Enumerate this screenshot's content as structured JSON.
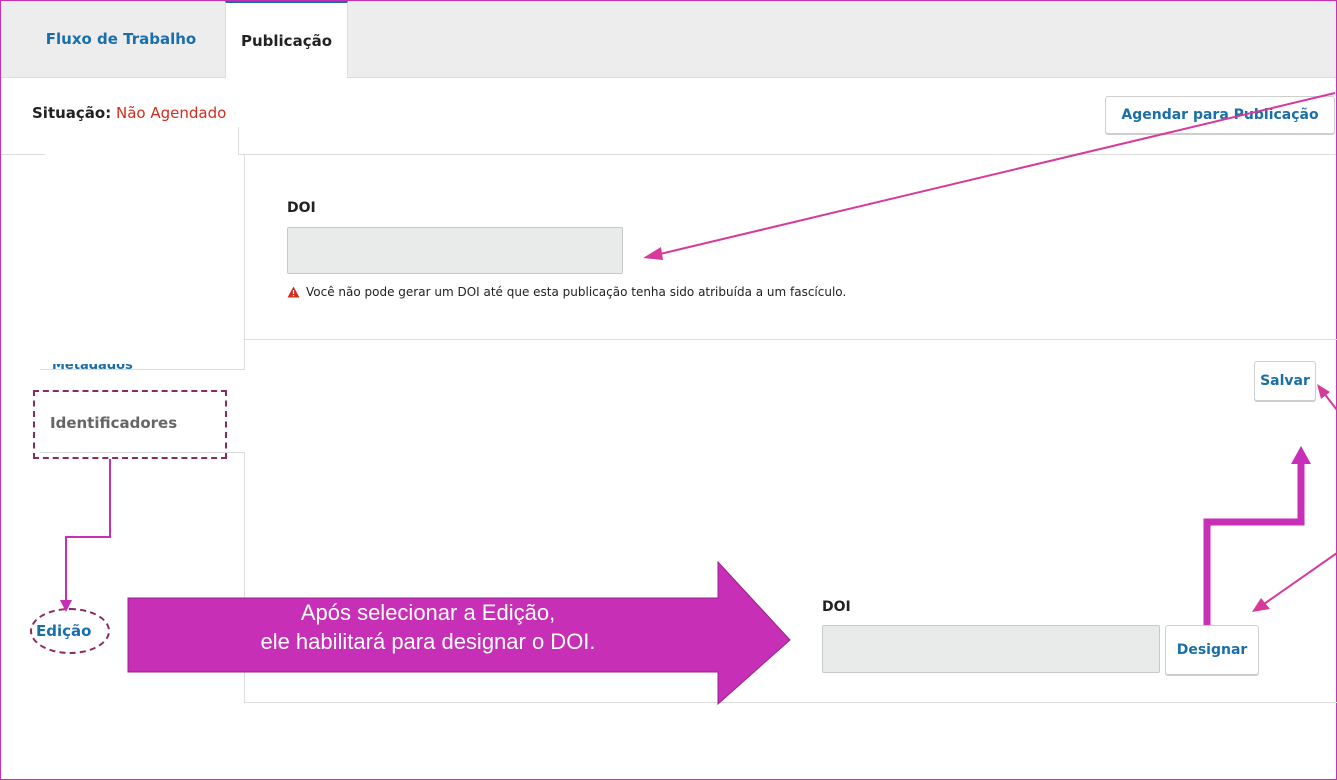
{
  "tabs": [
    {
      "label": "Fluxo de Trabalho"
    },
    {
      "label": "Publicação",
      "active": true
    }
  ],
  "status": {
    "label": "Situação:",
    "value": "Não Agendado"
  },
  "header": {
    "schedule_button": "Agendar para Publicação"
  },
  "sidebar": {
    "items": [
      {
        "label": "Identificadores"
      },
      {
        "label": "Edição"
      }
    ]
  },
  "doi_panel": {
    "label": "DOI",
    "value": "",
    "warning": "Você não pode gerar um DOI até que esta publicação tenha sido atribuída a um fascículo.",
    "save_button": "Salvar"
  },
  "doi_assign": {
    "label": "DOI",
    "value": "",
    "assign_button": "Designar"
  },
  "annotation": {
    "line1": "Após selecionar a Edição,",
    "line2": "ele habilitará para designar o DOI."
  },
  "colors": {
    "accent": "#1a6fa8",
    "status_red": "#d52b1e",
    "annotation_magenta": "#c72fb6",
    "annotation_dash": "#8a2a5e"
  }
}
